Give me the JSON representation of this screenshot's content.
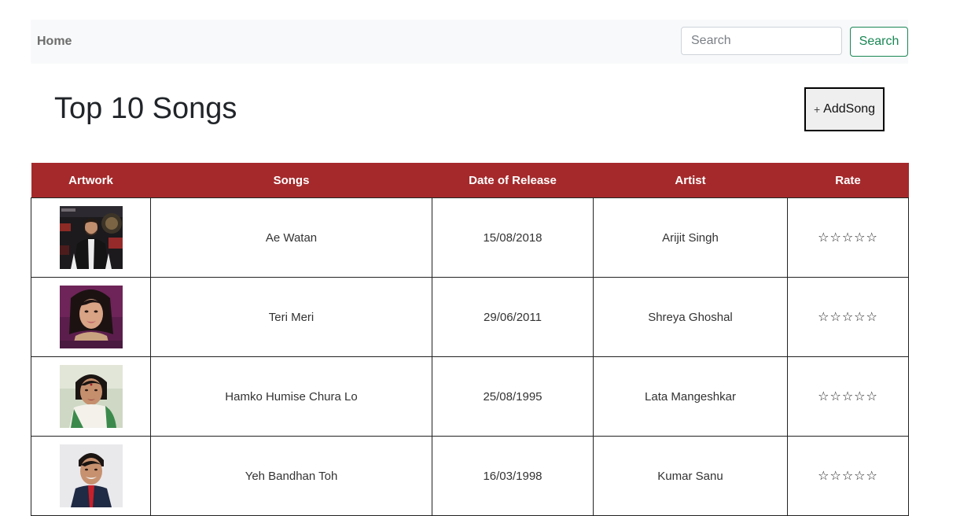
{
  "nav": {
    "home_label": "Home",
    "search_placeholder": "Search",
    "search_button_label": "Search"
  },
  "page": {
    "title": "Top 10 Songs",
    "add_song_label": "AddSong",
    "add_song_icon": "plus-icon"
  },
  "table": {
    "headers": [
      "Artwork",
      "Songs",
      "Date of Release",
      "Artist",
      "Rate"
    ],
    "rows": [
      {
        "song": "Ae Watan",
        "release_date": "15/08/2018",
        "artist": "Arijit Singh",
        "rating": "☆☆☆☆☆"
      },
      {
        "song": "Teri Meri",
        "release_date": "29/06/2011",
        "artist": "Shreya Ghoshal",
        "rating": "☆☆☆☆☆"
      },
      {
        "song": "Hamko Humise Chura Lo",
        "release_date": "25/08/1995",
        "artist": "Lata Mangeshkar",
        "rating": "☆☆☆☆☆"
      },
      {
        "song": "Yeh Bandhan Toh",
        "release_date": "16/03/1998",
        "artist": "Kumar Sanu",
        "rating": "☆☆☆☆☆"
      }
    ]
  },
  "colors": {
    "header_bg": "#a5292b",
    "navbar_bg": "#f8f9fa",
    "search_button": "#198754"
  }
}
